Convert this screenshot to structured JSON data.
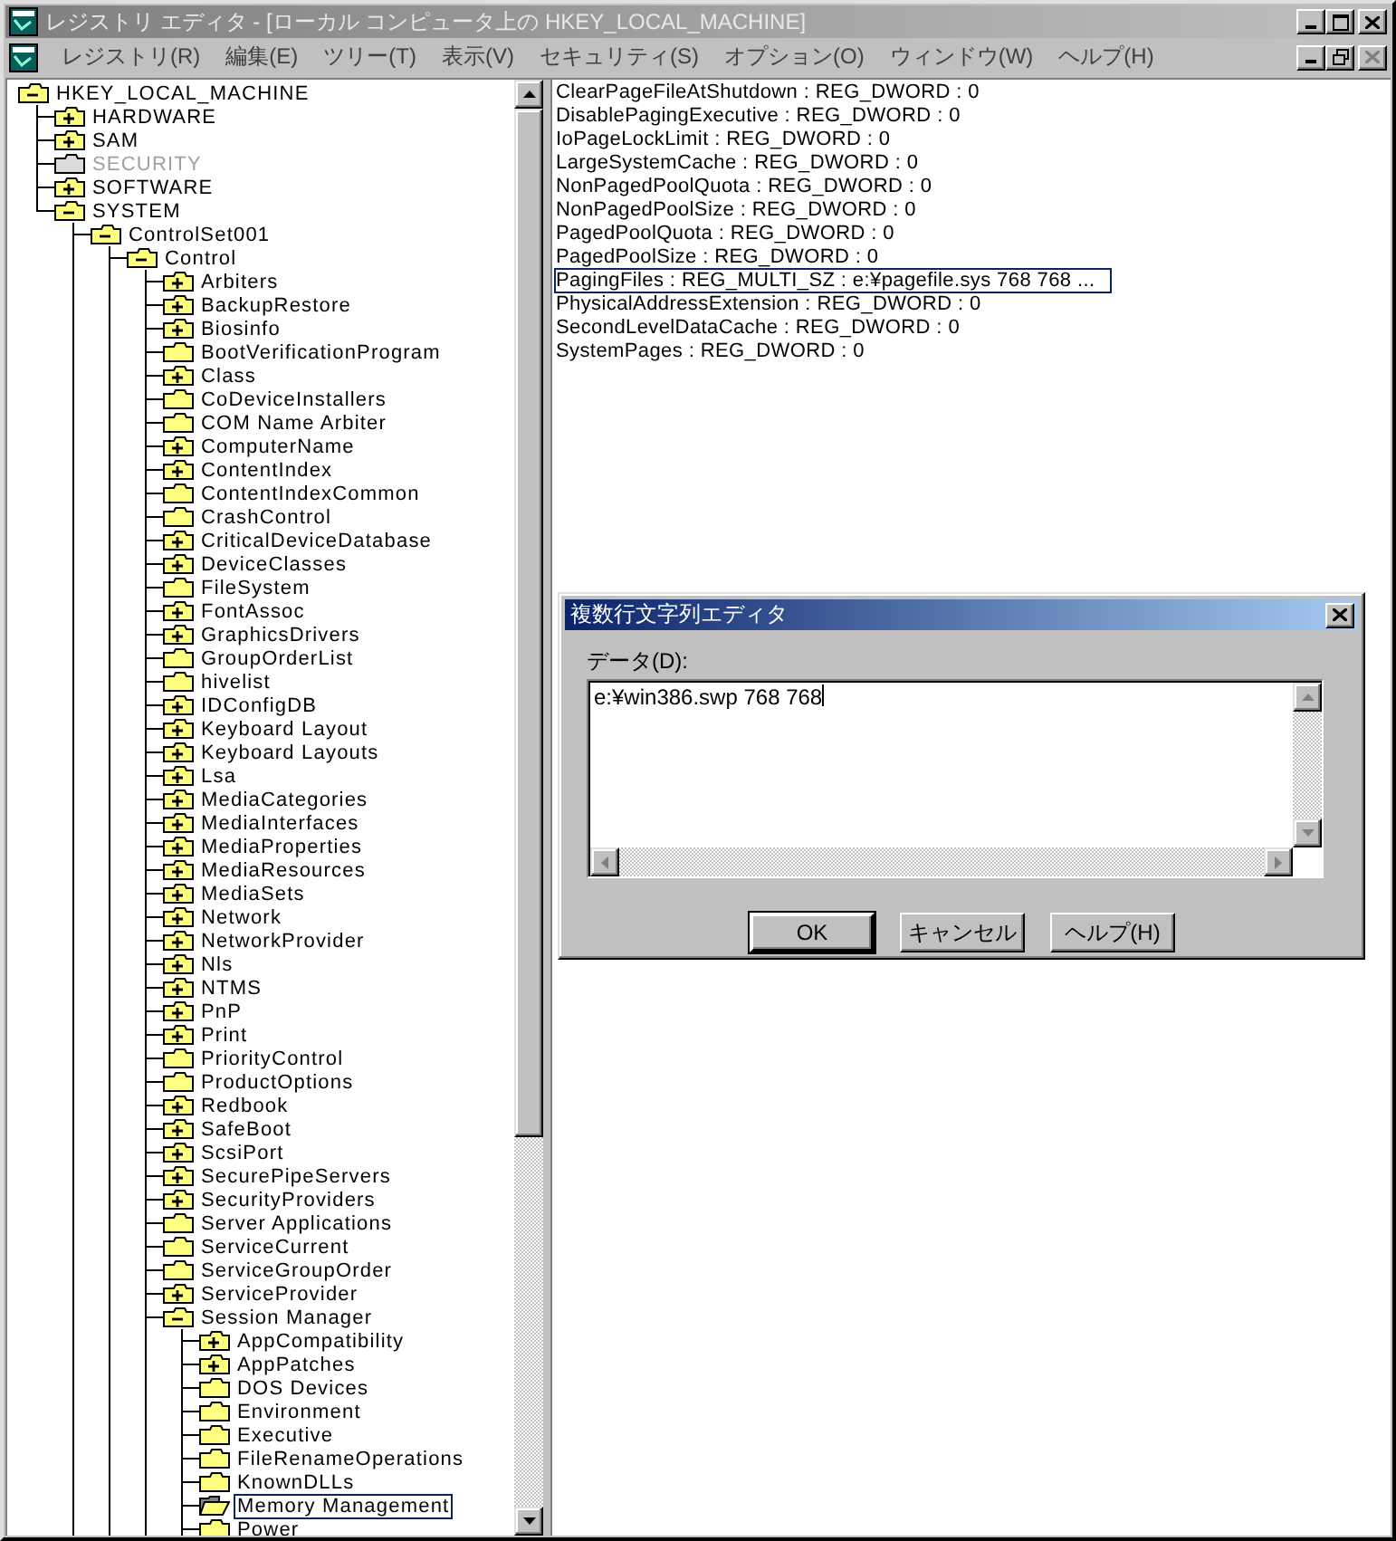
{
  "window": {
    "title": "レジストリ エディタ - [ローカル コンピュータ上の HKEY_LOCAL_MACHINE]"
  },
  "menu": [
    "レジストリ(R)",
    "編集(E)",
    "ツリー(T)",
    "表示(V)",
    "セキュリティ(S)",
    "オプション(O)",
    "ウィンドウ(W)",
    "ヘルプ(H)"
  ],
  "tree": {
    "label": "HKEY_LOCAL_MACHINE",
    "kind": "expanded",
    "selected": false,
    "continues": false,
    "children": [
      {
        "label": "HARDWARE",
        "kind": "collapsed",
        "selected": false,
        "disabled": false
      },
      {
        "label": "SAM",
        "kind": "collapsed",
        "selected": false,
        "disabled": false
      },
      {
        "label": "SECURITY",
        "kind": "leaf",
        "selected": false,
        "disabled": true
      },
      {
        "label": "SOFTWARE",
        "kind": "collapsed",
        "selected": false,
        "disabled": false
      },
      {
        "label": "SYSTEM",
        "kind": "expanded",
        "selected": false,
        "disabled": false,
        "continues": true,
        "children": [
          {
            "label": "ControlSet001",
            "kind": "expanded",
            "selected": false,
            "continues": true,
            "children": [
              {
                "label": "Control",
                "kind": "expanded",
                "selected": false,
                "continues": true,
                "children": [
                  {
                    "label": "Arbiters",
                    "kind": "collapsed",
                    "selected": false
                  },
                  {
                    "label": "BackupRestore",
                    "kind": "collapsed",
                    "selected": false
                  },
                  {
                    "label": "Biosinfo",
                    "kind": "collapsed",
                    "selected": false
                  },
                  {
                    "label": "BootVerificationProgram",
                    "kind": "leaf",
                    "selected": false
                  },
                  {
                    "label": "Class",
                    "kind": "collapsed",
                    "selected": false
                  },
                  {
                    "label": "CoDeviceInstallers",
                    "kind": "leaf",
                    "selected": false
                  },
                  {
                    "label": "COM Name Arbiter",
                    "kind": "leaf",
                    "selected": false
                  },
                  {
                    "label": "ComputerName",
                    "kind": "collapsed",
                    "selected": false
                  },
                  {
                    "label": "ContentIndex",
                    "kind": "collapsed",
                    "selected": false
                  },
                  {
                    "label": "ContentIndexCommon",
                    "kind": "leaf",
                    "selected": false
                  },
                  {
                    "label": "CrashControl",
                    "kind": "leaf",
                    "selected": false
                  },
                  {
                    "label": "CriticalDeviceDatabase",
                    "kind": "collapsed",
                    "selected": false
                  },
                  {
                    "label": "DeviceClasses",
                    "kind": "collapsed",
                    "selected": false
                  },
                  {
                    "label": "FileSystem",
                    "kind": "leaf",
                    "selected": false
                  },
                  {
                    "label": "FontAssoc",
                    "kind": "collapsed",
                    "selected": false
                  },
                  {
                    "label": "GraphicsDrivers",
                    "kind": "collapsed",
                    "selected": false
                  },
                  {
                    "label": "GroupOrderList",
                    "kind": "leaf",
                    "selected": false
                  },
                  {
                    "label": "hivelist",
                    "kind": "leaf",
                    "selected": false
                  },
                  {
                    "label": "IDConfigDB",
                    "kind": "collapsed",
                    "selected": false
                  },
                  {
                    "label": "Keyboard Layout",
                    "kind": "collapsed",
                    "selected": false
                  },
                  {
                    "label": "Keyboard Layouts",
                    "kind": "collapsed",
                    "selected": false
                  },
                  {
                    "label": "Lsa",
                    "kind": "collapsed",
                    "selected": false
                  },
                  {
                    "label": "MediaCategories",
                    "kind": "collapsed",
                    "selected": false
                  },
                  {
                    "label": "MediaInterfaces",
                    "kind": "collapsed",
                    "selected": false
                  },
                  {
                    "label": "MediaProperties",
                    "kind": "collapsed",
                    "selected": false
                  },
                  {
                    "label": "MediaResources",
                    "kind": "collapsed",
                    "selected": false
                  },
                  {
                    "label": "MediaSets",
                    "kind": "collapsed",
                    "selected": false
                  },
                  {
                    "label": "Network",
                    "kind": "collapsed",
                    "selected": false
                  },
                  {
                    "label": "NetworkProvider",
                    "kind": "collapsed",
                    "selected": false
                  },
                  {
                    "label": "Nls",
                    "kind": "collapsed",
                    "selected": false
                  },
                  {
                    "label": "NTMS",
                    "kind": "collapsed",
                    "selected": false
                  },
                  {
                    "label": "PnP",
                    "kind": "collapsed",
                    "selected": false
                  },
                  {
                    "label": "Print",
                    "kind": "collapsed",
                    "selected": false
                  },
                  {
                    "label": "PriorityControl",
                    "kind": "leaf",
                    "selected": false
                  },
                  {
                    "label": "ProductOptions",
                    "kind": "leaf",
                    "selected": false
                  },
                  {
                    "label": "Redbook",
                    "kind": "collapsed",
                    "selected": false
                  },
                  {
                    "label": "SafeBoot",
                    "kind": "collapsed",
                    "selected": false
                  },
                  {
                    "label": "ScsiPort",
                    "kind": "collapsed",
                    "selected": false
                  },
                  {
                    "label": "SecurePipeServers",
                    "kind": "collapsed",
                    "selected": false
                  },
                  {
                    "label": "SecurityProviders",
                    "kind": "collapsed",
                    "selected": false
                  },
                  {
                    "label": "Server Applications",
                    "kind": "leaf",
                    "selected": false
                  },
                  {
                    "label": "ServiceCurrent",
                    "kind": "leaf",
                    "selected": false
                  },
                  {
                    "label": "ServiceGroupOrder",
                    "kind": "leaf",
                    "selected": false
                  },
                  {
                    "label": "ServiceProvider",
                    "kind": "collapsed",
                    "selected": false
                  },
                  {
                    "label": "Session Manager",
                    "kind": "expanded",
                    "selected": false,
                    "continues": true,
                    "children": [
                      {
                        "label": "AppCompatibility",
                        "kind": "collapsed",
                        "selected": false
                      },
                      {
                        "label": "AppPatches",
                        "kind": "collapsed",
                        "selected": false
                      },
                      {
                        "label": "DOS Devices",
                        "kind": "leaf",
                        "selected": false
                      },
                      {
                        "label": "Environment",
                        "kind": "leaf",
                        "selected": false
                      },
                      {
                        "label": "Executive",
                        "kind": "leaf",
                        "selected": false
                      },
                      {
                        "label": "FileRenameOperations",
                        "kind": "leaf",
                        "selected": false
                      },
                      {
                        "label": "KnownDLLs",
                        "kind": "leaf",
                        "selected": false
                      },
                      {
                        "label": "Memory Management",
                        "kind": "leaf",
                        "selected": true
                      },
                      {
                        "label": "Power",
                        "kind": "leaf",
                        "selected": false
                      }
                    ]
                  }
                ]
              }
            ]
          }
        ]
      }
    ]
  },
  "values": [
    {
      "text": "ClearPageFileAtShutdown : REG_DWORD : 0",
      "selected": false
    },
    {
      "text": "DisablePagingExecutive : REG_DWORD : 0",
      "selected": false
    },
    {
      "text": "IoPageLockLimit : REG_DWORD : 0",
      "selected": false
    },
    {
      "text": "LargeSystemCache : REG_DWORD : 0",
      "selected": false
    },
    {
      "text": "NonPagedPoolQuota : REG_DWORD : 0",
      "selected": false
    },
    {
      "text": "NonPagedPoolSize : REG_DWORD : 0",
      "selected": false
    },
    {
      "text": "PagedPoolQuota : REG_DWORD : 0",
      "selected": false
    },
    {
      "text": "PagedPoolSize : REG_DWORD : 0",
      "selected": false
    },
    {
      "text": "PagingFiles : REG_MULTI_SZ : e:¥pagefile.sys 768 768 ...",
      "selected": true
    },
    {
      "text": "PhysicalAddressExtension : REG_DWORD : 0",
      "selected": false
    },
    {
      "text": "SecondLevelDataCache : REG_DWORD : 0",
      "selected": false
    },
    {
      "text": "SystemPages : REG_DWORD : 0",
      "selected": false
    }
  ],
  "dialog": {
    "title": "複数行文字列エディタ",
    "label": "データ(D):",
    "value": "e:¥win386.swp 768 768",
    "buttons": [
      {
        "label": "OK",
        "default": true
      },
      {
        "label": "キャンセル",
        "default": false
      },
      {
        "label": "ヘルプ(H)",
        "default": false
      }
    ]
  }
}
